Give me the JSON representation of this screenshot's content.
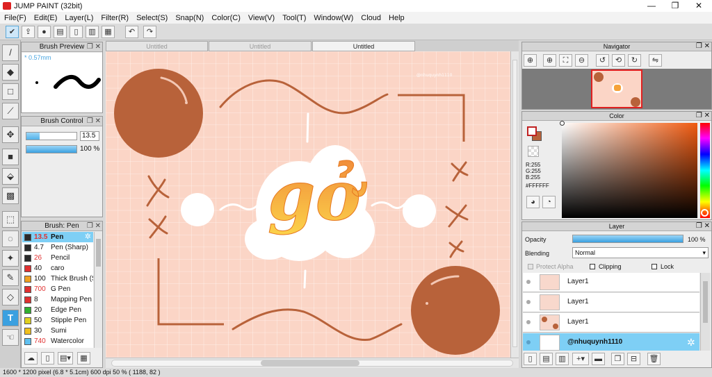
{
  "app": {
    "title": "JUMP PAINT (32bit)"
  },
  "window_controls": {
    "minimize": "—",
    "maximize": "❐",
    "close": "✕"
  },
  "menu": [
    "File(F)",
    "Edit(E)",
    "Layer(L)",
    "Filter(R)",
    "Select(S)",
    "Snap(N)",
    "Color(C)",
    "View(V)",
    "Tool(T)",
    "Window(W)",
    "Cloud",
    "Help"
  ],
  "brush_preview": {
    "title": "Brush Preview",
    "size": "* 0.57mm"
  },
  "brush_control": {
    "title": "Brush Control",
    "size_value": "13.5",
    "opacity_value": "100 %",
    "size_fraction": 0.27,
    "opacity_fraction": 1.0
  },
  "brush_list": {
    "title": "Brush: Pen",
    "items": [
      {
        "size": "13.5",
        "name": "Pen",
        "color": "#2a2a2a",
        "selected": true
      },
      {
        "size": "4.7",
        "name": "Pen (Sharp)",
        "color": "#2a2a2a"
      },
      {
        "size": "26",
        "name": "Pencil",
        "color": "#2a2a2a"
      },
      {
        "size": "40",
        "name": "caro",
        "color": "#e03030"
      },
      {
        "size": "100",
        "name": "Thick Brush (Si",
        "color": "#f0a020"
      },
      {
        "size": "700",
        "name": "G Pen",
        "color": "#e03030"
      },
      {
        "size": "8",
        "name": "Mapping Pen",
        "color": "#e03030"
      },
      {
        "size": "20",
        "name": "Edge Pen",
        "color": "#30b030"
      },
      {
        "size": "50",
        "name": "Stipple Pen",
        "color": "#e0d020"
      },
      {
        "size": "30",
        "name": "Sumi",
        "color": "#f0c020"
      },
      {
        "size": "740",
        "name": "Watercolor",
        "color": "#60c0f0"
      }
    ]
  },
  "tabs": [
    {
      "label": "Untitled",
      "active": false
    },
    {
      "label": "Untitled",
      "active": false
    },
    {
      "label": "Untitled",
      "active": true
    }
  ],
  "navigator": {
    "title": "Navigator"
  },
  "color_panel": {
    "title": "Color",
    "r": "R:255",
    "g": "G:255",
    "b": "B:255",
    "hex": "#FFFFFF"
  },
  "layer_panel": {
    "title": "Layer",
    "opacity_label": "Opacity",
    "opacity_value": "100 %",
    "blending_label": "Blending",
    "blending_value": "Normal",
    "protect_alpha": "Protect Alpha",
    "clipping": "Clipping",
    "lock": "Lock",
    "layers": [
      {
        "name": "Layer1",
        "selected": false
      },
      {
        "name": "Layer1",
        "selected": false
      },
      {
        "name": "Layer1",
        "selected": false
      },
      {
        "name": "@nhuquynh1110",
        "selected": true
      }
    ]
  },
  "canvas_text": {
    "main": "gở",
    "watermark": "@nhuquynh1110"
  },
  "status": {
    "text": "1600 * 1200 pixel   (6.8 * 5.1cm)   600 dpi   50 %   ( 1188, 82 )"
  },
  "colors": {
    "accent": "#7ecff5",
    "canvas_bg": "#fbd5c6",
    "brown": "#b8623a",
    "orange": "#f5a23a"
  }
}
